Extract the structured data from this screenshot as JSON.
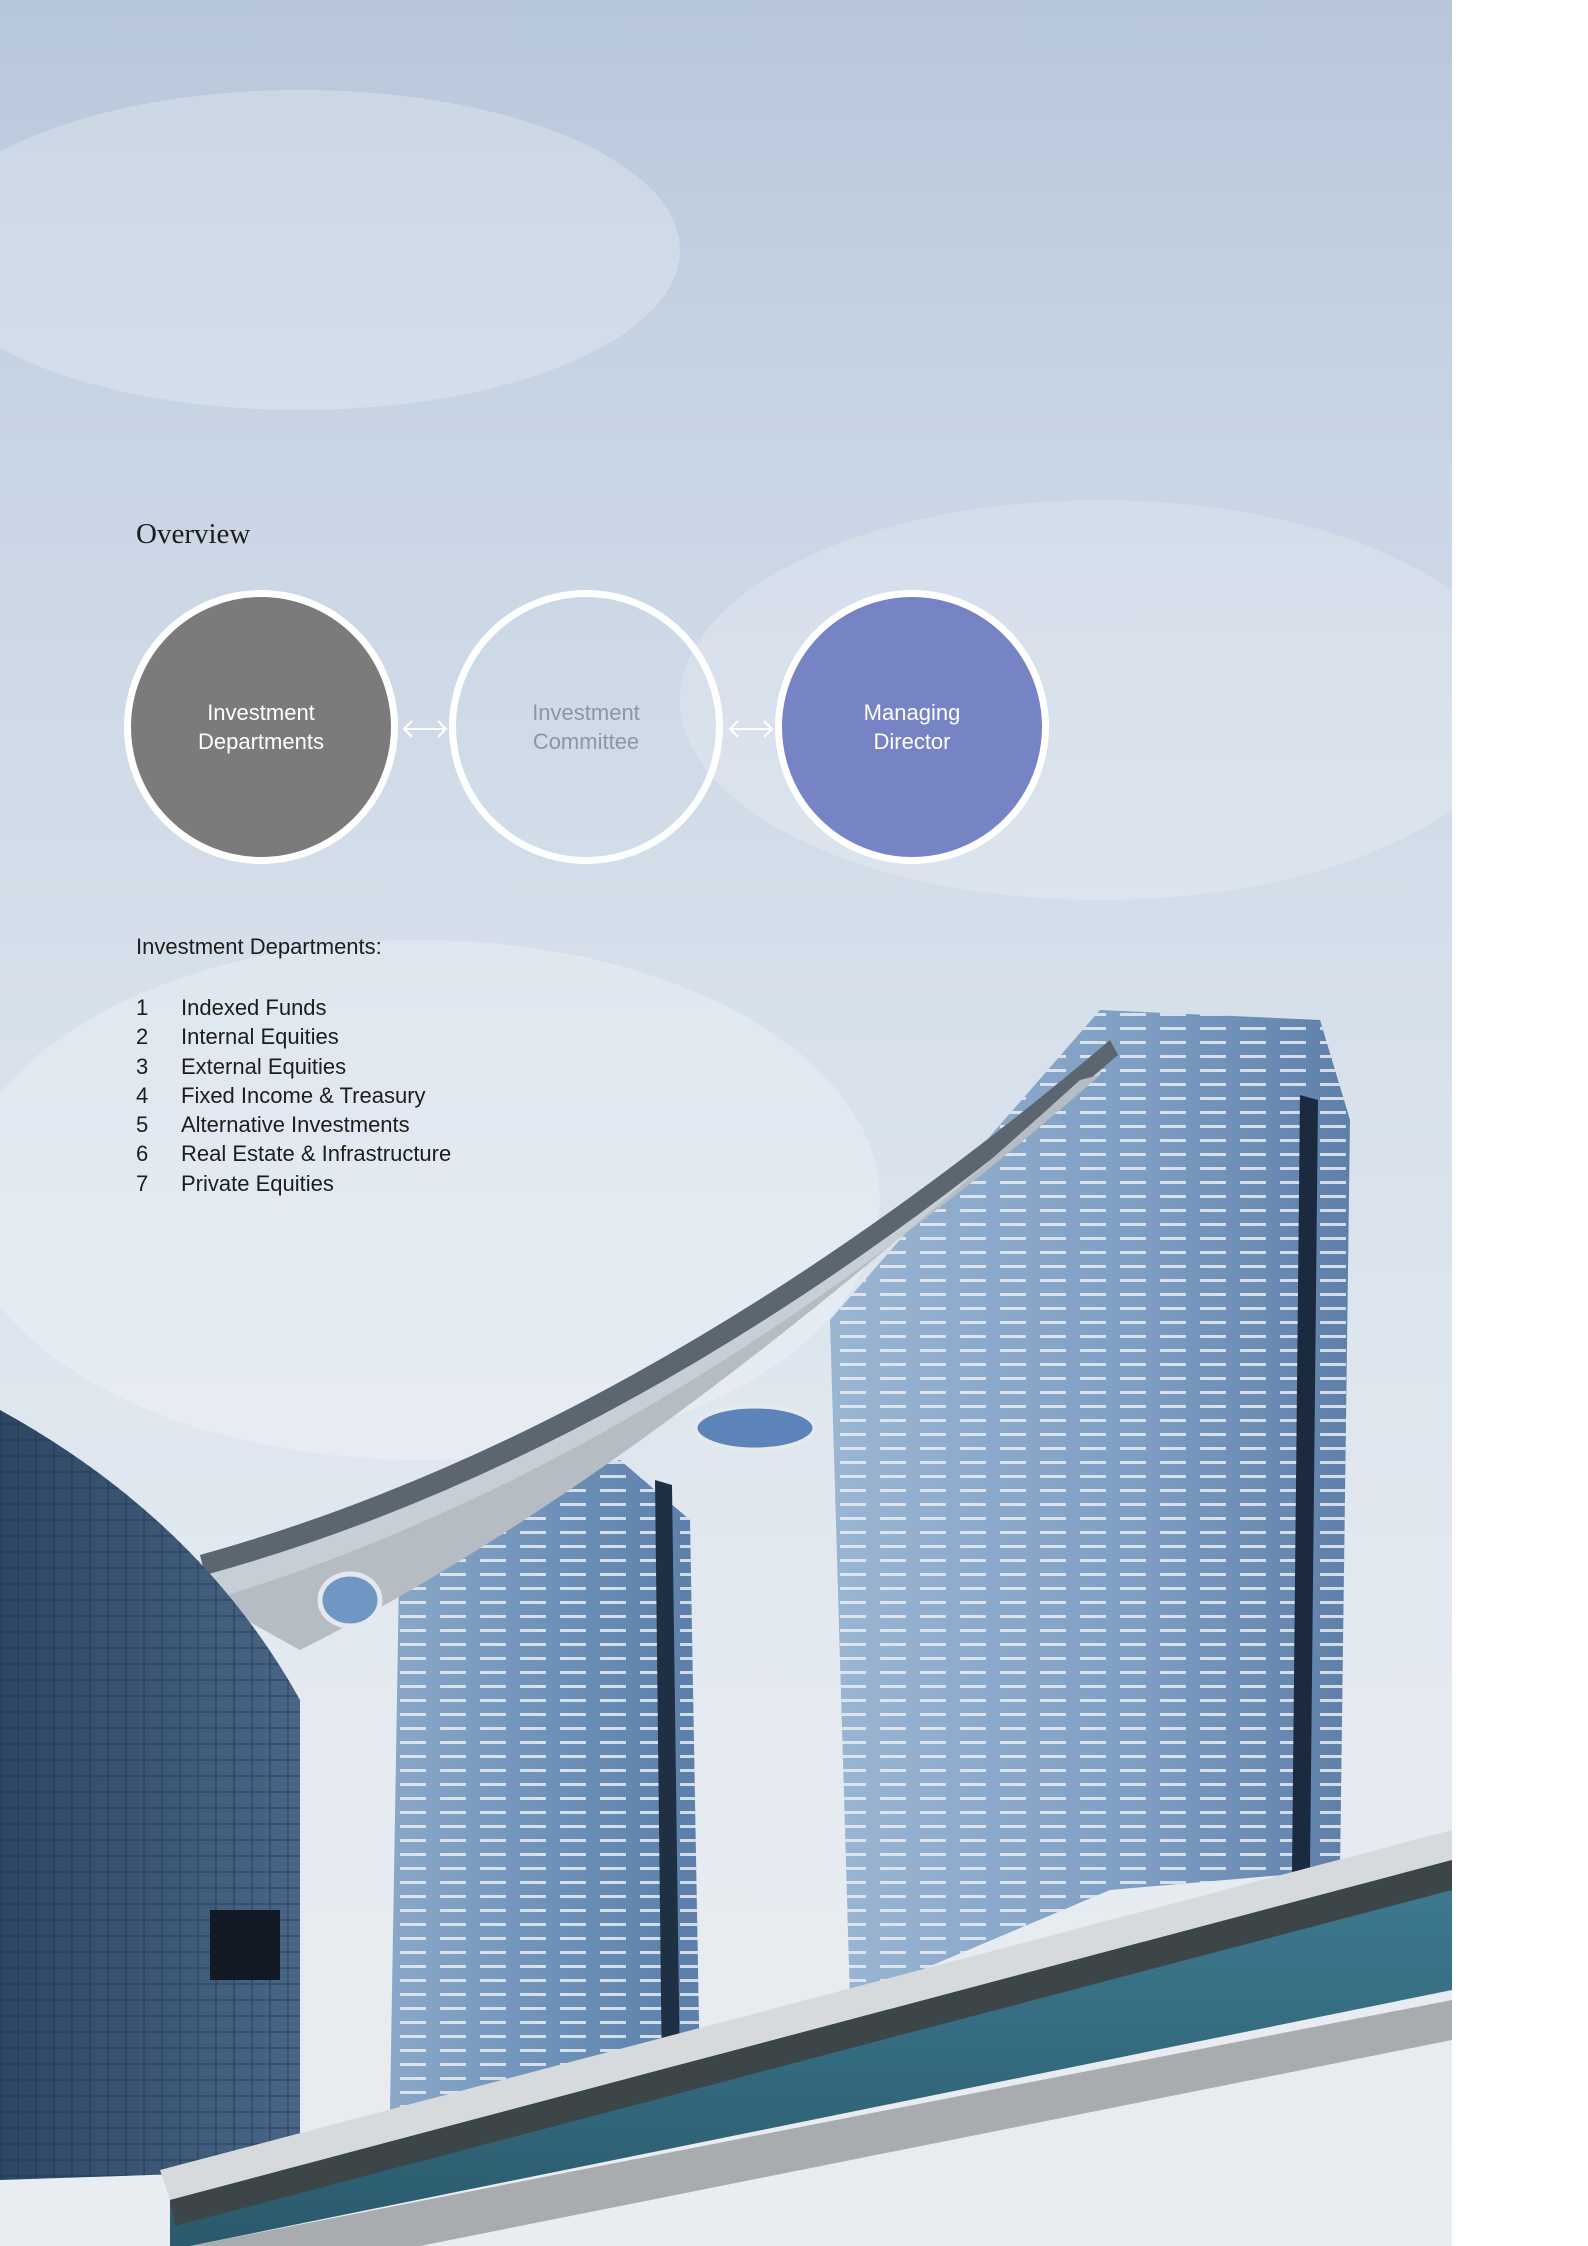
{
  "section": {
    "title": "Overview"
  },
  "flow": {
    "nodes": [
      {
        "label": "Investment\nDepartments",
        "fill": "#7b7b7b",
        "text_color": "#ffffff"
      },
      {
        "label": "Investment\nCommittee",
        "fill": "transparent",
        "text_color": "#8d96a3"
      },
      {
        "label": "Managing\nDirector",
        "fill": "#7683c4",
        "text_color": "#ffffff"
      }
    ],
    "connector_icon": "double-headed-arrow-icon"
  },
  "departments": {
    "heading": "Investment Departments:",
    "items": [
      {
        "num": "1",
        "label": "Indexed Funds"
      },
      {
        "num": "2",
        "label": "Internal Equities"
      },
      {
        "num": "3",
        "label": "External Equities"
      },
      {
        "num": "4",
        "label": "Fixed Income & Treasury"
      },
      {
        "num": "5",
        "label": "Alternative Investments"
      },
      {
        "num": "6",
        "label": "Real Estate & Infrastructure"
      },
      {
        "num": "7",
        "label": "Private Equities"
      }
    ]
  },
  "colors": {
    "sky": "#c9d6e5",
    "tower_glass": "#7a9cc0",
    "bridge": "#4d5a5e",
    "accent_purple": "#7683c4",
    "node_grey": "#7b7b7b"
  }
}
